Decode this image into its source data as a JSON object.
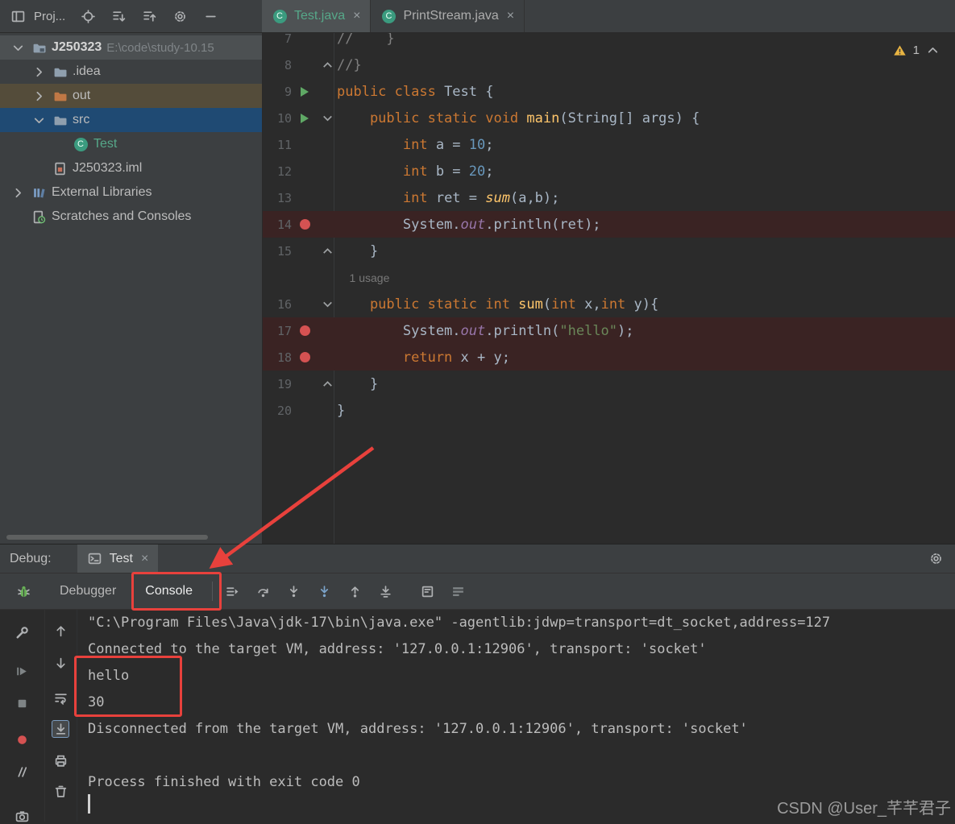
{
  "colors": {
    "panel_bg": "#3c3f41",
    "editor_bg": "#2b2b2b",
    "keyword": "#cc7832",
    "plain_text": "#a9b7c6",
    "number": "#6897bb",
    "string": "#6a8759",
    "method": "#ffc66b",
    "field": "#9876aa",
    "comment": "#808080",
    "breakpoint_line_bg": "#3a2323",
    "breakpoint_dot": "#d55252",
    "selected_row_bg": "#1f4a73",
    "excluded_row_bg": "#544c3a",
    "root_row_bg": "#4c5052",
    "added_file_text": "#56a889",
    "annotation_red": "#e8413c"
  },
  "project_toolbar": {
    "title": "Proj...",
    "left_icon": "window-icon",
    "icons": [
      "locate-icon",
      "collapse-all-icon",
      "expand-all-icon",
      "gear-icon",
      "minimize-icon"
    ]
  },
  "editor_tabs": [
    {
      "label": "Test.java",
      "icon": "class-icon",
      "selected": true,
      "added": true
    },
    {
      "label": "PrintStream.java",
      "icon": "class-icon",
      "selected": false,
      "added": false
    }
  ],
  "project_tree": [
    {
      "name": "J250323",
      "path": "E:\\code\\study-10.15",
      "icon": "project-folder-icon",
      "chevron": "down",
      "indent": 0,
      "bold": true,
      "bg": "root"
    },
    {
      "name": ".idea",
      "icon": "folder-icon",
      "chevron": "right",
      "indent": 1
    },
    {
      "name": "out",
      "icon": "excluded-folder-icon",
      "chevron": "right",
      "indent": 1,
      "bg": "excluded"
    },
    {
      "name": "src",
      "icon": "folder-icon",
      "chevron": "down",
      "indent": 1,
      "bg": "selected"
    },
    {
      "name": "Test",
      "icon": "class-icon",
      "indent": 2,
      "added": true
    },
    {
      "name": "J250323.iml",
      "icon": "iml-icon",
      "indent": 1
    },
    {
      "name": "External Libraries",
      "icon": "libraries-icon",
      "chevron": "right",
      "indent": 0
    },
    {
      "name": "Scratches and Consoles",
      "icon": "scratches-icon",
      "indent": 0
    }
  ],
  "editor": {
    "inspection": {
      "warnings": "1"
    },
    "lines": [
      {
        "num": "7",
        "tokens": [
          {
            "t": "c",
            "s": "//    }"
          }
        ]
      },
      {
        "num": "8",
        "fold": "end",
        "tokens": [
          {
            "t": "c",
            "s": "//}"
          }
        ]
      },
      {
        "num": "9",
        "run": true,
        "tokens": [
          {
            "t": "k",
            "s": "public class "
          },
          {
            "t": "p",
            "s": "Test {"
          }
        ]
      },
      {
        "num": "10",
        "run": true,
        "fold": "open",
        "tokens": [
          {
            "t": "k",
            "s": "    public static void "
          },
          {
            "t": "m",
            "s": "main"
          },
          {
            "t": "p",
            "s": "(String[] args) {"
          }
        ]
      },
      {
        "num": "11",
        "tokens": [
          {
            "t": "k",
            "s": "        int"
          },
          {
            "t": "p",
            "s": " a = "
          },
          {
            "t": "num",
            "s": "10"
          },
          {
            "t": "p",
            "s": ";"
          }
        ]
      },
      {
        "num": "12",
        "tokens": [
          {
            "t": "k",
            "s": "        int"
          },
          {
            "t": "p",
            "s": " b = "
          },
          {
            "t": "num",
            "s": "20"
          },
          {
            "t": "p",
            "s": ";"
          }
        ]
      },
      {
        "num": "13",
        "tokens": [
          {
            "t": "k",
            "s": "        int"
          },
          {
            "t": "p",
            "s": " ret = "
          },
          {
            "t": "mi",
            "s": "sum"
          },
          {
            "t": "p",
            "s": "(a,b);"
          }
        ]
      },
      {
        "num": "14",
        "bp": true,
        "hl": true,
        "tokens": [
          {
            "t": "p",
            "s": "        System."
          },
          {
            "t": "f",
            "s": "out"
          },
          {
            "t": "p",
            "s": ".println(ret);"
          }
        ]
      },
      {
        "num": "15",
        "fold": "end",
        "tokens": [
          {
            "t": "p",
            "s": "    }"
          }
        ]
      },
      {
        "num": "",
        "hint": "1 usage",
        "tokens": []
      },
      {
        "num": "16",
        "fold": "open",
        "tokens": [
          {
            "t": "k",
            "s": "    public static int "
          },
          {
            "t": "m",
            "s": "sum"
          },
          {
            "t": "p",
            "s": "("
          },
          {
            "t": "k",
            "s": "int"
          },
          {
            "t": "p",
            "s": " x,"
          },
          {
            "t": "k",
            "s": "int"
          },
          {
            "t": "p",
            "s": " y){"
          }
        ]
      },
      {
        "num": "17",
        "bp": true,
        "hl": true,
        "tokens": [
          {
            "t": "p",
            "s": "        System."
          },
          {
            "t": "f",
            "s": "out"
          },
          {
            "t": "p",
            "s": ".println("
          },
          {
            "t": "str",
            "s": "\"hello\""
          },
          {
            "t": "p",
            "s": ");"
          }
        ]
      },
      {
        "num": "18",
        "bp": true,
        "hl": true,
        "tokens": [
          {
            "t": "k",
            "s": "        return"
          },
          {
            "t": "p",
            "s": " x + y;"
          }
        ]
      },
      {
        "num": "19",
        "fold": "end",
        "tokens": [
          {
            "t": "p",
            "s": "    }"
          }
        ]
      },
      {
        "num": "20",
        "tokens": [
          {
            "t": "p",
            "s": "}"
          }
        ]
      }
    ]
  },
  "debug": {
    "header_label": "Debug:",
    "session_tab": {
      "label": "Test",
      "icon": "console-app-icon"
    },
    "view_tabs": [
      {
        "label": "Debugger",
        "selected": false
      },
      {
        "label": "Console",
        "selected": true
      }
    ],
    "toolbar_icons": [
      "show-execution-icon",
      "step-over-icon",
      "step-into-icon",
      "force-step-into-icon",
      "step-out-icon",
      "run-to-cursor-icon",
      "evaluate-icon",
      "threads-icon"
    ],
    "left_strip_icons": [
      "wrench-icon",
      "resume-icon",
      "stop-icon",
      "view-breakpoints-icon",
      "mute-breakpoints-icon",
      "camera-icon"
    ],
    "console_strip_icons": [
      "arrow-up-icon",
      "arrow-down-icon",
      "soft-wrap-icon",
      "scroll-end-icon",
      "print-icon",
      "trash-icon"
    ]
  },
  "console_lines": [
    "\"C:\\Program Files\\Java\\jdk-17\\bin\\java.exe\" -agentlib:jdwp=transport=dt_socket,address=127",
    "Connected to the target VM, address: '127.0.0.1:12906', transport: 'socket'",
    "hello",
    "30",
    "Disconnected from the target VM, address: '127.0.0.1:12906', transport: 'socket'",
    "",
    "Process finished with exit code 0"
  ],
  "watermark": "CSDN @User_芊芊君子"
}
